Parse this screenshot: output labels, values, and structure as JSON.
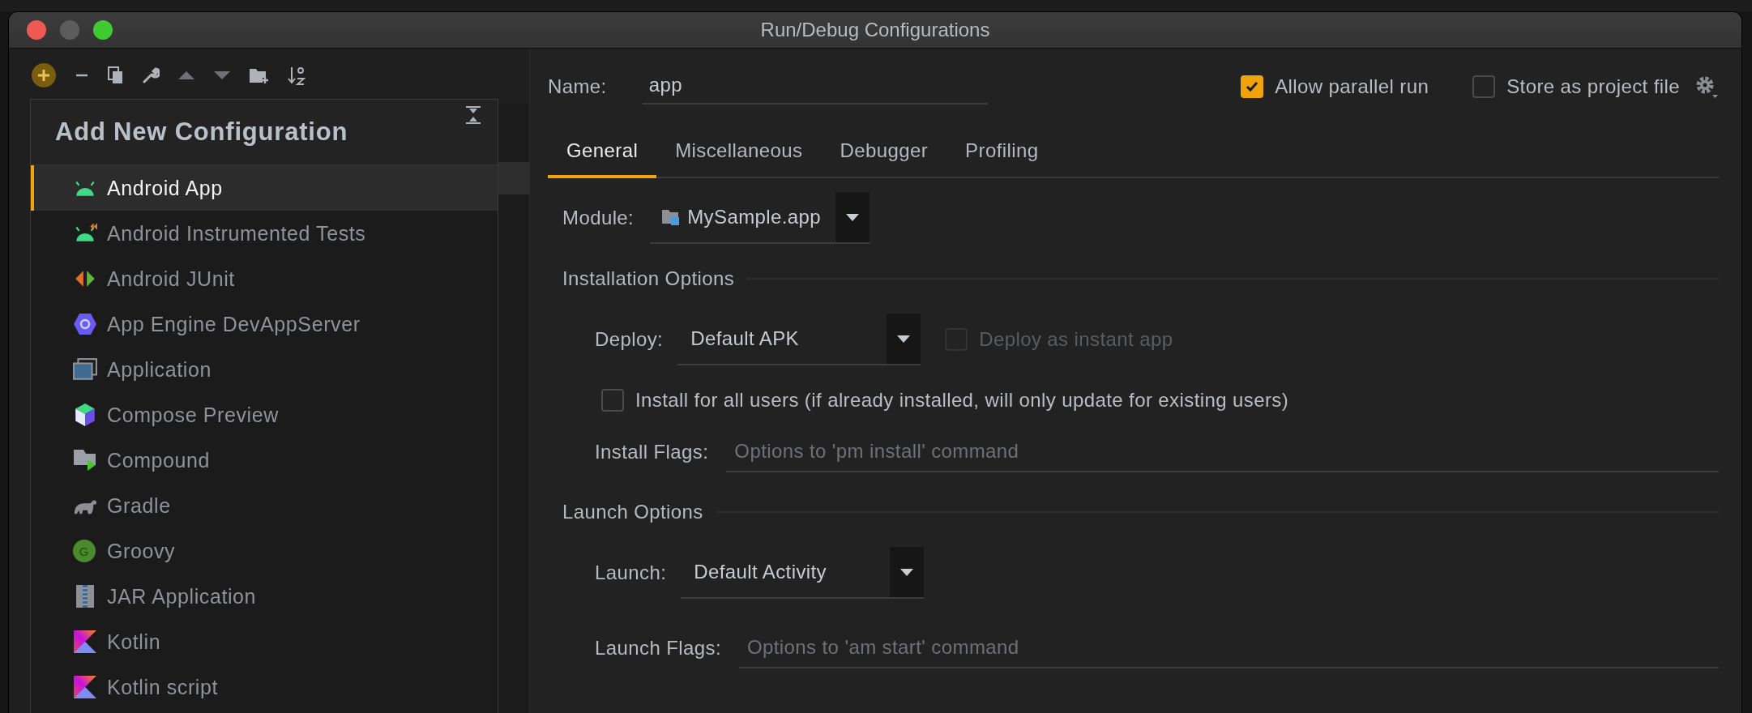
{
  "window": {
    "title": "Run/Debug Configurations"
  },
  "add_configuration_popup": {
    "title": "Add New Configuration",
    "items": [
      {
        "label": "Android App",
        "kind": "android",
        "selected": true
      },
      {
        "label": "Android Instrumented Tests",
        "kind": "android-test",
        "selected": false
      },
      {
        "label": "Android JUnit",
        "kind": "junit",
        "selected": false
      },
      {
        "label": "App Engine DevAppServer",
        "kind": "appengine",
        "selected": false
      },
      {
        "label": "Application",
        "kind": "application",
        "selected": false
      },
      {
        "label": "Compose Preview",
        "kind": "compose",
        "selected": false
      },
      {
        "label": "Compound",
        "kind": "compound",
        "selected": false
      },
      {
        "label": "Gradle",
        "kind": "gradle",
        "selected": false
      },
      {
        "label": "Groovy",
        "kind": "groovy",
        "icon_text": "G",
        "selected": false
      },
      {
        "label": "JAR Application",
        "kind": "jar",
        "selected": false
      },
      {
        "label": "Kotlin",
        "kind": "kotlin",
        "selected": false
      },
      {
        "label": "Kotlin script",
        "kind": "kotlin",
        "selected": false
      }
    ]
  },
  "name_field": {
    "label": "Name:",
    "value": "app"
  },
  "allow_parallel_run": {
    "label": "Allow parallel run",
    "checked": true
  },
  "store_as_project_file": {
    "label": "Store as project file",
    "checked": false
  },
  "tabs": [
    {
      "label": "General",
      "selected": true
    },
    {
      "label": "Miscellaneous",
      "selected": false
    },
    {
      "label": "Debugger",
      "selected": false
    },
    {
      "label": "Profiling",
      "selected": false
    }
  ],
  "module": {
    "label": "Module:",
    "value": "MySample.app"
  },
  "installation_options": {
    "title": "Installation Options",
    "deploy": {
      "label": "Deploy:",
      "value": "Default APK"
    },
    "deploy_as_instant_app": {
      "label": "Deploy as instant app",
      "checked": false,
      "disabled": true
    },
    "install_for_all_users": {
      "label": "Install for all users (if already installed, will only update for existing users)",
      "checked": false,
      "disabled": false
    },
    "install_flags": {
      "label": "Install Flags:",
      "placeholder": "Options to 'pm install' command"
    }
  },
  "launch_options": {
    "title": "Launch Options",
    "launch": {
      "label": "Launch:",
      "value": "Default Activity"
    },
    "launch_flags": {
      "label": "Launch Flags:",
      "placeholder": "Options to 'am start' command"
    }
  }
}
